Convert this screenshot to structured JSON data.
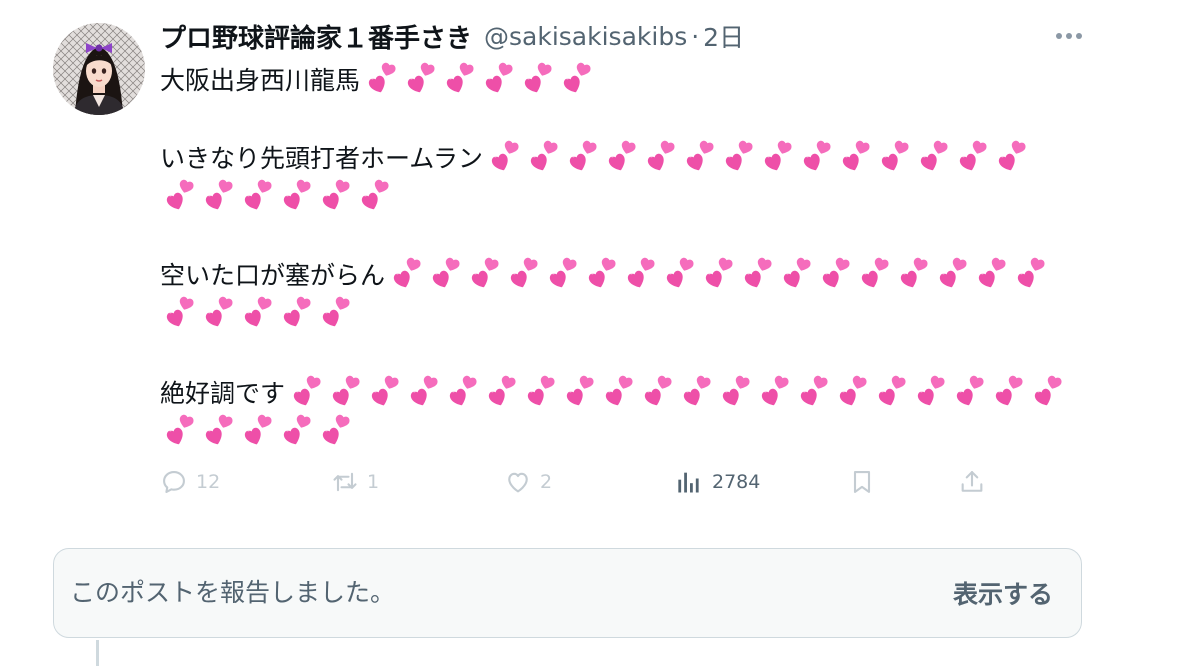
{
  "tweet": {
    "author_name": "プロ野球評論家１番手さき",
    "handle": "@sakisakisakibs",
    "separator": "·",
    "time": "2日",
    "lines": [
      {
        "text": "大阪出身西川龍馬",
        "hearts": 6
      },
      {
        "text": "いきなり先頭打者ホームラン",
        "hearts": 14
      },
      {
        "text": "",
        "hearts": 6
      },
      {
        "text": "空いた口が塞がらん",
        "hearts": 17
      },
      {
        "text": "",
        "hearts": 5
      },
      {
        "text": "絶好調です",
        "hearts": 20
      },
      {
        "text": "",
        "hearts": 5
      }
    ],
    "emoji_icon": "two-hearts-icon"
  },
  "actions": {
    "reply": {
      "icon": "reply-icon",
      "count": "12"
    },
    "retweet": {
      "icon": "retweet-icon",
      "count": "1"
    },
    "like": {
      "icon": "heart-icon",
      "count": "2"
    },
    "views": {
      "icon": "analytics-icon",
      "count": "2784"
    },
    "bookmark": {
      "icon": "bookmark-icon"
    },
    "share": {
      "icon": "share-icon"
    }
  },
  "report": {
    "text": "このポストを報告しました。",
    "show_label": "表示する"
  },
  "colors": {
    "text": "#0f1419",
    "secondary": "#536471",
    "faded": "#c4ccd2",
    "heart_pink": "#f25fb4",
    "report_bg": "#f7f9f9",
    "border": "#cfd9de"
  }
}
